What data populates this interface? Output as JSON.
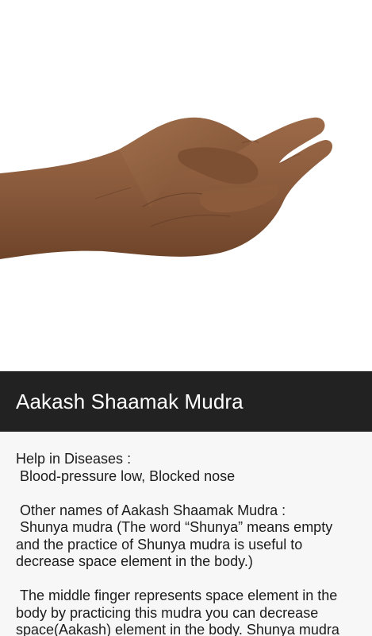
{
  "hero_image": {
    "icon": "mudra-hand-photo",
    "skin_color": "#8a5a3c"
  },
  "title_bar": {
    "title": "Aakash Shaamak Mudra",
    "background": "#222222"
  },
  "content": {
    "diseases_heading": "Help in Diseases :",
    "diseases_list": " Blood-pressure low, Blocked nose",
    "other_names_heading": " Other names of Aakash Shaamak Mudra :",
    "other_names_text": " Shunya mudra (The word “Shunya” means empty and the practice of Shunya mudra is useful to decrease space element in the body.)",
    "description_text": " The middle finger represents space element in the body by practicing this mudra you can decrease space(Aakash) element in the body. Shunya mudra"
  }
}
